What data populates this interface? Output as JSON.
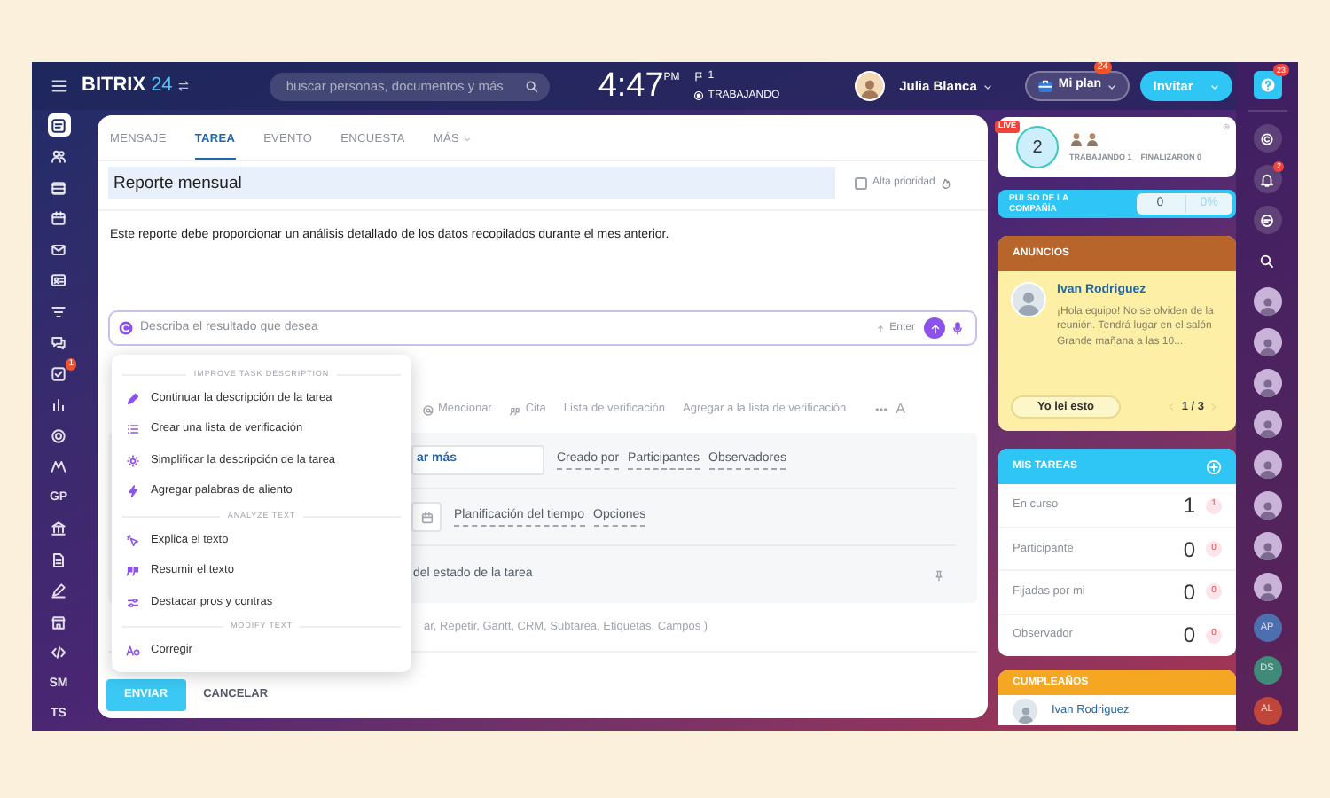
{
  "topbar": {
    "logo": "BITRIX",
    "logo_number": "24",
    "search": {
      "placeholder": "buscar personas, documentos y más"
    },
    "clock": {
      "time": "4:47",
      "suffix": "PM"
    },
    "flag_count": "1",
    "work_status": "TRABAJANDO",
    "user": {
      "name": "Julia Blanca"
    },
    "plan_button": {
      "label": "Mi plan",
      "badge": "24"
    },
    "invite_button": {
      "label": "Invitar"
    },
    "help_badge": "23"
  },
  "left_sidebar": {
    "items": [
      {
        "kind": "icon",
        "selected": true
      },
      {
        "kind": "icon",
        "selected": false
      },
      {
        "kind": "icon",
        "selected": false
      },
      {
        "kind": "icon",
        "selected": false
      },
      {
        "kind": "icon",
        "selected": false
      },
      {
        "kind": "icon",
        "selected": false
      },
      {
        "kind": "icon",
        "selected": false
      },
      {
        "kind": "icon",
        "selected": false
      },
      {
        "kind": "icon",
        "selected": false,
        "badge": "1"
      },
      {
        "kind": "icon",
        "selected": false
      },
      {
        "kind": "icon",
        "selected": false
      },
      {
        "kind": "icon",
        "selected": false
      },
      {
        "kind": "text",
        "label": "GP",
        "selected": false
      },
      {
        "kind": "icon",
        "selected": false
      },
      {
        "kind": "icon",
        "selected": false
      },
      {
        "kind": "icon",
        "selected": false
      },
      {
        "kind": "icon",
        "selected": false
      },
      {
        "kind": "icon",
        "selected": false
      },
      {
        "kind": "text",
        "label": "SM",
        "selected": false
      },
      {
        "kind": "text",
        "label": "TS",
        "selected": false
      }
    ]
  },
  "composer": {
    "tabs": [
      {
        "label": "MENSAJE",
        "selected": false,
        "has_menu": false
      },
      {
        "label": "TAREA",
        "selected": true,
        "has_menu": false
      },
      {
        "label": "EVENTO",
        "selected": false,
        "has_menu": false
      },
      {
        "label": "ENCUESTA",
        "selected": false,
        "has_menu": false
      },
      {
        "label": "MÁS",
        "selected": false,
        "has_menu": true
      }
    ],
    "title": {
      "value": "Reporte mensual"
    },
    "high_priority": {
      "label": "Alta prioridad",
      "checked": false
    },
    "description": "Este reporte debe proporcionar un análisis detallado de los datos recopilados durante el mes anterior.",
    "ai_prompt": {
      "placeholder": "Describa el resultado que desea",
      "send_hint": "Enter"
    },
    "toolbar": {
      "items": [
        "Mencionar",
        "Cita",
        "Lista de verificación",
        "Agregar a la lista de verificación"
      ],
      "font_button": "A"
    },
    "options": {
      "responsible_field": "ar más",
      "people_links": [
        "Creado por",
        "Participantes",
        "Observadores"
      ],
      "time_links": [
        "Planificación del tiempo",
        "Opciones"
      ],
      "status_text": "del estado de la tarea",
      "more_fields": "ar, Repetir, Gantt, CRM, Subtarea, Etiquetas, Campos )"
    },
    "buttons": [
      {
        "label": "ENVIAR",
        "kind": "primary"
      },
      {
        "label": "CANCELAR",
        "kind": "link"
      }
    ]
  },
  "ai_menu": {
    "sections": [
      {
        "title": "IMPROVE TASK DESCRIPTION",
        "items": [
          "Continuar la descripción de la tarea",
          "Crear una lista de verificación",
          "Simplificar la descripción de la tarea",
          "Agregar palabras de aliento"
        ]
      },
      {
        "title": "ANALYZE TEXT",
        "items": [
          "Explica el texto",
          "Resumir el texto",
          "Destacar pros y contras"
        ]
      },
      {
        "title": "MODIFY TEXT",
        "items": [
          "Corregir"
        ]
      }
    ]
  },
  "right_panel": {
    "live": {
      "badge": "LIVE",
      "count": "2",
      "stats": [
        "TRABAJANDO 1",
        "FINALIZARON 0"
      ]
    },
    "pulse": {
      "label": "PULSO DE LA COMPAÑÍA",
      "value": "0",
      "percent": "0%"
    },
    "announcements": {
      "title": "ANUNCIOS",
      "author": "Ivan Rodriguez",
      "message": "¡Hola equipo! No se olviden de la reunión. Tendrá lugar en el salón Grande mañana a las 10...",
      "button": "Yo lei esto",
      "pager": "1 / 3"
    },
    "my_tasks": {
      "title": "MIS TAREAS",
      "rows": [
        {
          "label": "En curso",
          "count": "1",
          "badge": "1"
        },
        {
          "label": "Participante",
          "count": "0",
          "badge": "0"
        },
        {
          "label": "Fijadas por mi",
          "count": "0",
          "badge": "0"
        },
        {
          "label": "Observador",
          "count": "0",
          "badge": "0"
        }
      ]
    },
    "birthdays": {
      "title": "CUMPLEAÑOS",
      "people": [
        "Ivan Rodriguez"
      ]
    }
  },
  "right_strip": {
    "items": [
      {
        "kind": "icon"
      },
      {
        "kind": "icon",
        "badge": "2"
      },
      {
        "kind": "icon"
      },
      {
        "kind": "search"
      },
      {
        "kind": "avatar"
      },
      {
        "kind": "avatar"
      },
      {
        "kind": "avatar"
      },
      {
        "kind": "avatar"
      },
      {
        "kind": "avatar"
      },
      {
        "kind": "avatar"
      },
      {
        "kind": "avatar"
      },
      {
        "kind": "avatar"
      },
      {
        "kind": "initials",
        "label": "AP",
        "color": "#4d6fb0"
      },
      {
        "kind": "initials",
        "label": "DS",
        "color": "#3f8a78"
      },
      {
        "kind": "initials",
        "label": "AL",
        "color": "#c0453a"
      }
    ]
  }
}
